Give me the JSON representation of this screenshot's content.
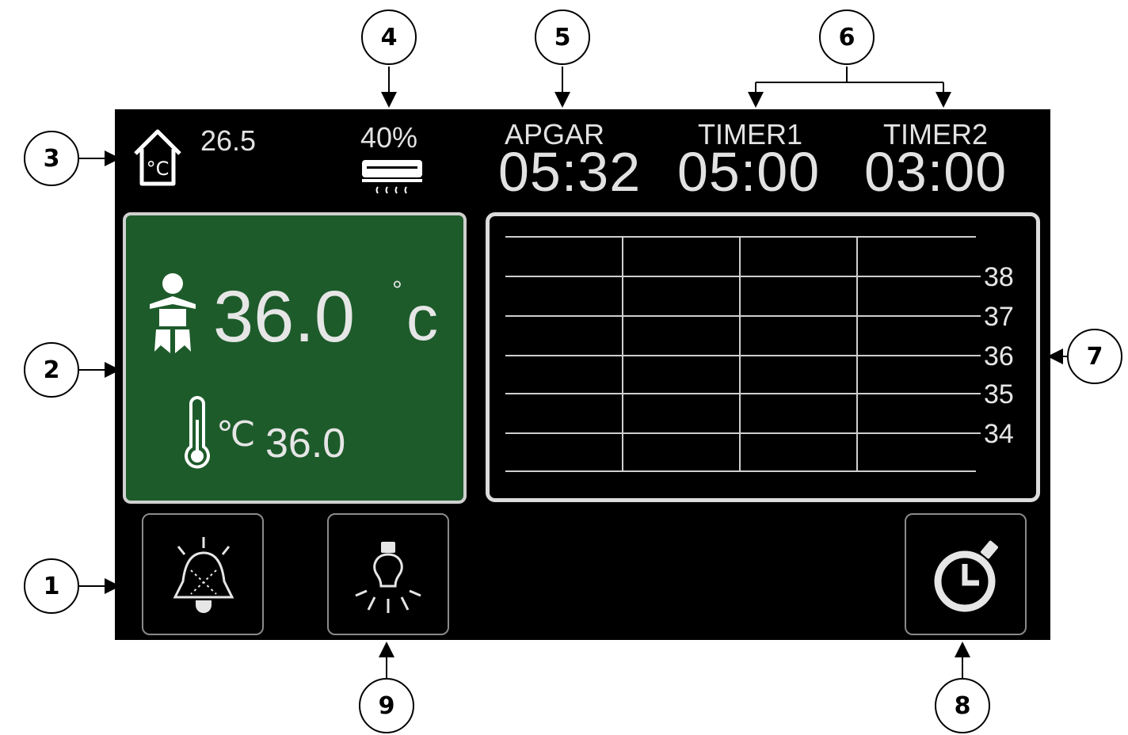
{
  "callouts": {
    "c1": "1",
    "c2": "2",
    "c3": "3",
    "c4": "4",
    "c5": "5",
    "c6": "6",
    "c7": "7",
    "c8": "8",
    "c9": "9"
  },
  "status_bar": {
    "ambient_temperature": "26.5",
    "ambient_icon": "house-thermometer-icon",
    "humidity": "40%",
    "humidity_icon": "humidifier-icon",
    "apgar": {
      "label": "APGAR",
      "value": "05:32"
    },
    "timer1": {
      "label": "TIMER1",
      "value": "05:00"
    },
    "timer2": {
      "label": "TIMER2",
      "value": "03:00"
    }
  },
  "temperature_panel": {
    "baby_icon": "baby-icon",
    "baby_temperature": "36.0",
    "baby_unit_degree": "°",
    "baby_unit": "c",
    "set_icon": "thermometer-icon",
    "set_unit": "℃",
    "set_temperature": "36.0",
    "background_color": "#1e5b2b"
  },
  "trend_graph": {
    "y_ticks": [
      "38",
      "37",
      "36",
      "35",
      "34"
    ]
  },
  "buttons": {
    "alarm_icon": "alarm-bell-icon",
    "light_icon": "light-bulb-icon",
    "timer_icon": "stopwatch-icon"
  }
}
